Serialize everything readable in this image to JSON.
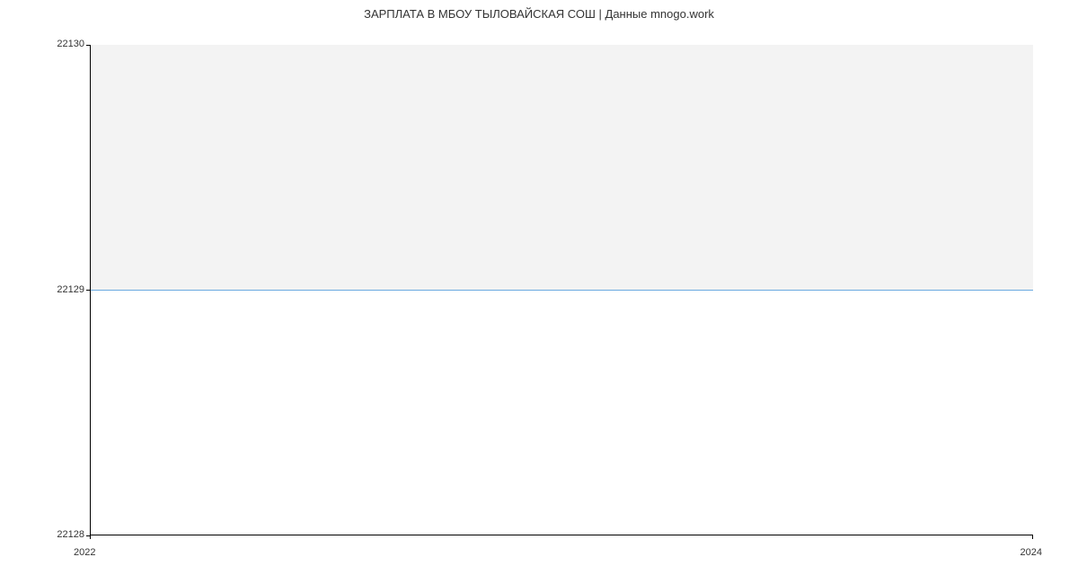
{
  "chart_data": {
    "type": "line",
    "title": "ЗАРПЛАТА В МБОУ ТЫЛОВАЙСКАЯ СОШ | Данные mnogo.work",
    "xlabel": "",
    "ylabel": "",
    "x": [
      2022,
      2024
    ],
    "values": [
      22129,
      22129
    ],
    "ylim": [
      22128,
      22130
    ],
    "xlim": [
      2022,
      2024
    ],
    "y_ticks": [
      22128,
      22129,
      22130
    ],
    "x_ticks": [
      2022,
      2024
    ]
  },
  "title": "ЗАРПЛАТА В МБОУ ТЫЛОВАЙСКАЯ СОШ | Данные mnogo.work",
  "y_labels": {
    "top": "22130",
    "mid": "22129",
    "bot": "22128"
  },
  "x_labels": {
    "left": "2022",
    "right": "2024"
  }
}
